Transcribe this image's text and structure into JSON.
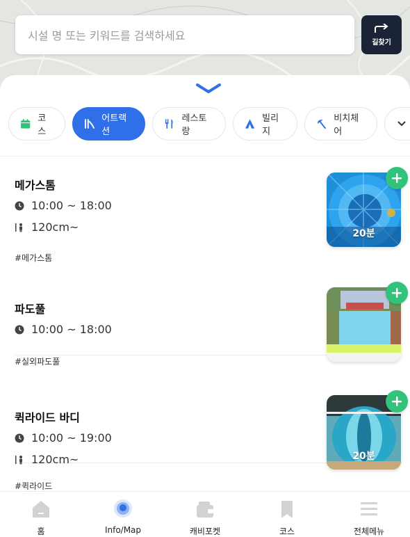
{
  "search": {
    "placeholder": "시설 명 또는 키워드를 검색하세요",
    "route_label": "길찾기"
  },
  "categories": [
    {
      "label": "코스",
      "icon": "calendar-icon",
      "active": false
    },
    {
      "label": "어트랙션",
      "icon": "slide-icon",
      "active": true
    },
    {
      "label": "레스토랑",
      "icon": "fork-knife-icon",
      "active": false
    },
    {
      "label": "빌리지",
      "icon": "tent-icon",
      "active": false
    },
    {
      "label": "비치체어",
      "icon": "parasol-icon",
      "active": false
    }
  ],
  "items": [
    {
      "title": "메가스톰",
      "hours": "10:00 ~ 18:00",
      "height": "120cm~",
      "tag": "#메가스톰",
      "duration": "20분"
    },
    {
      "title": "파도풀",
      "hours": "10:00 ~ 18:00",
      "tag": "#실외파도풀"
    },
    {
      "title": "퀵라이드 바디",
      "hours": "10:00 ~ 19:00",
      "height": "120cm~",
      "tag": "#퀵라이드",
      "duration": "20분"
    }
  ],
  "tabs": [
    {
      "label": "홈",
      "icon": "home-icon"
    },
    {
      "label": "Info/Map",
      "icon": "map-pin-icon",
      "active": true
    },
    {
      "label": "캐비포켓",
      "icon": "wallet-icon"
    },
    {
      "label": "코스",
      "icon": "bookmark-icon"
    },
    {
      "label": "전체메뉴",
      "icon": "menu-icon"
    }
  ],
  "colors": {
    "accent": "#2f6fe8",
    "add_button": "#31c27b",
    "route_button": "#1b2337"
  }
}
